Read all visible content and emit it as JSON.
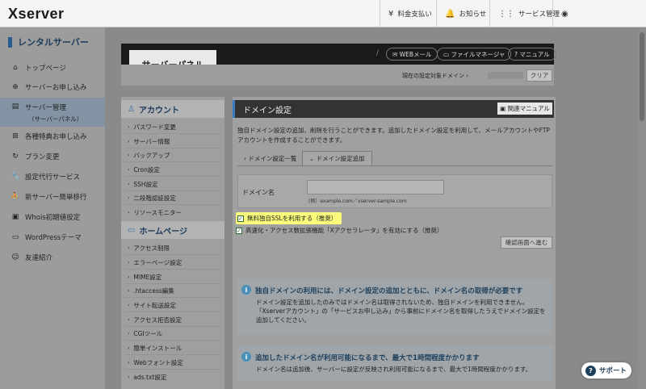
{
  "header": {
    "logo": "Xserver",
    "nav": [
      {
        "icon": "yen-icon",
        "glyph": "¥",
        "label": "料金支払い"
      },
      {
        "icon": "bell-icon",
        "glyph": "🔔",
        "label": "お知らせ"
      },
      {
        "icon": "grid-icon",
        "glyph": "⋮⋮",
        "label": "サービス管理"
      },
      {
        "icon": "user-icon",
        "glyph": "◉",
        "label": ""
      }
    ]
  },
  "sidebar": {
    "title": "レンタルサーバー",
    "items": [
      {
        "icon": "home-icon",
        "glyph": "⌂",
        "label": "トップページ"
      },
      {
        "icon": "plus-circle-icon",
        "glyph": "⊕",
        "label": "サーバーお申し込み"
      },
      {
        "icon": "server-icon",
        "glyph": "▤",
        "label": "サーバー管理",
        "sub": "（サーバーパネル）"
      },
      {
        "icon": "cart-icon",
        "glyph": "⊞",
        "label": "各種特典お申し込み"
      },
      {
        "icon": "refresh-icon",
        "glyph": "↻",
        "label": "プラン変更"
      },
      {
        "icon": "wrench-icon",
        "glyph": "🔧",
        "label": "設定代行サービス"
      },
      {
        "icon": "person-move-icon",
        "glyph": "⛹",
        "label": "新サーバー簡単移行"
      },
      {
        "icon": "whois-icon",
        "glyph": "▣",
        "label": "Whois初期値設定"
      },
      {
        "icon": "wordpress-icon",
        "glyph": "▭",
        "label": "WordPressテーマ"
      },
      {
        "icon": "referral-icon",
        "glyph": "☺",
        "label": "友達紹介"
      }
    ]
  },
  "panel": {
    "title": "サーバーパネル",
    "buttons": [
      "WEBメール",
      "ファイルマネージャ",
      "マニュアル"
    ],
    "domain_label": "現在の設定対象ドメイン ›",
    "clear": "クリア"
  },
  "submenu": {
    "account_head": "アカウント",
    "account_items": [
      "パスワード変更",
      "サーバー情報",
      "バックアップ",
      "Cron設定",
      "SSH設定",
      "二段階認証設定",
      "リソースモニター"
    ],
    "home_head": "ホームページ",
    "home_items": [
      "アクセス制限",
      "エラーページ設定",
      "MIME設定",
      ".htaccess編集",
      "サイト転送設定",
      "アクセス拒否設定",
      "CGIツール",
      "簡単インストール",
      "Webフォント設定",
      "ads.txt設定"
    ]
  },
  "main": {
    "title": "ドメイン設定",
    "manual_button": "関連マニュアル",
    "description": "独自ドメイン設定の追加、削除を行うことができます。追加したドメイン設定を利用して、メールアカウントやFTPアカウントを作成することができます。",
    "tabs": [
      "ドメイン設定一覧",
      "ドメイン設定追加"
    ],
    "form_label": "ドメイン名",
    "form_placeholder": "",
    "form_hint": "(例）example.com／xserver-sample.com",
    "checkbox1": "無料独自SSLを利用する（推奨）",
    "checkbox2": "高速化・アクセス数拡張機能「Xアクセラレータ」を有効にする（推奨）",
    "confirm": "確認画面へ進む",
    "info1_title": "独自ドメインの利用には、ドメイン設定の追加とともに、ドメイン名の取得が必要です",
    "info1_body": "ドメイン設定を追加したのみではドメイン名は取得されないため、独自ドメインを利用できません。「Xserverアカウント」の「サービスお申し込み」から事前にドメイン名を取得したうえでドメイン設定を追加してください。",
    "info2_title": "追加したドメイン名が利用可能になるまで、最大で1時間程度かかります",
    "info2_body": "ドメイン名は追加後、サーバーに設定が反映され利用可能になるまで、最大で1時間程度かかります。"
  },
  "support": "サポート"
}
